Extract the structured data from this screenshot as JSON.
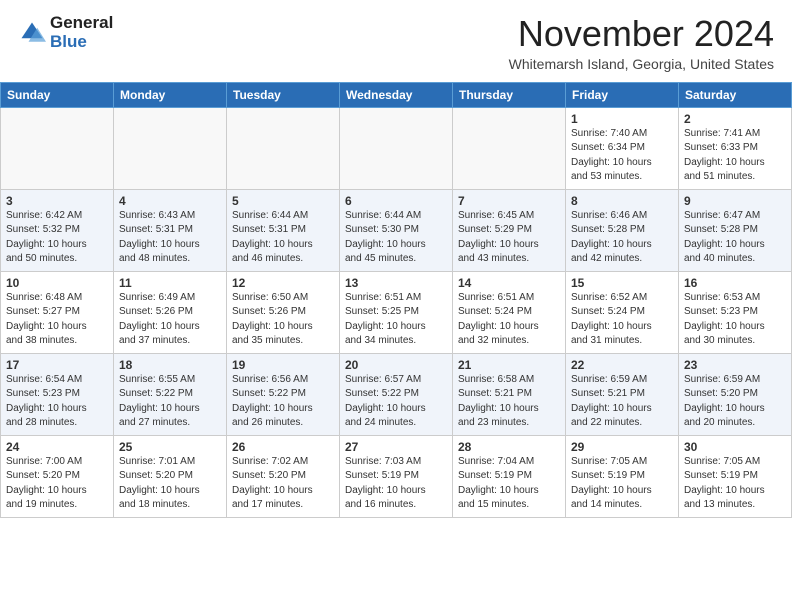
{
  "header": {
    "logo_general": "General",
    "logo_blue": "Blue",
    "month_title": "November 2024",
    "subtitle": "Whitemarsh Island, Georgia, United States"
  },
  "weekdays": [
    "Sunday",
    "Monday",
    "Tuesday",
    "Wednesday",
    "Thursday",
    "Friday",
    "Saturday"
  ],
  "weeks": [
    [
      {
        "day": "",
        "info": ""
      },
      {
        "day": "",
        "info": ""
      },
      {
        "day": "",
        "info": ""
      },
      {
        "day": "",
        "info": ""
      },
      {
        "day": "",
        "info": ""
      },
      {
        "day": "1",
        "info": "Sunrise: 7:40 AM\nSunset: 6:34 PM\nDaylight: 10 hours\nand 53 minutes."
      },
      {
        "day": "2",
        "info": "Sunrise: 7:41 AM\nSunset: 6:33 PM\nDaylight: 10 hours\nand 51 minutes."
      }
    ],
    [
      {
        "day": "3",
        "info": "Sunrise: 6:42 AM\nSunset: 5:32 PM\nDaylight: 10 hours\nand 50 minutes."
      },
      {
        "day": "4",
        "info": "Sunrise: 6:43 AM\nSunset: 5:31 PM\nDaylight: 10 hours\nand 48 minutes."
      },
      {
        "day": "5",
        "info": "Sunrise: 6:44 AM\nSunset: 5:31 PM\nDaylight: 10 hours\nand 46 minutes."
      },
      {
        "day": "6",
        "info": "Sunrise: 6:44 AM\nSunset: 5:30 PM\nDaylight: 10 hours\nand 45 minutes."
      },
      {
        "day": "7",
        "info": "Sunrise: 6:45 AM\nSunset: 5:29 PM\nDaylight: 10 hours\nand 43 minutes."
      },
      {
        "day": "8",
        "info": "Sunrise: 6:46 AM\nSunset: 5:28 PM\nDaylight: 10 hours\nand 42 minutes."
      },
      {
        "day": "9",
        "info": "Sunrise: 6:47 AM\nSunset: 5:28 PM\nDaylight: 10 hours\nand 40 minutes."
      }
    ],
    [
      {
        "day": "10",
        "info": "Sunrise: 6:48 AM\nSunset: 5:27 PM\nDaylight: 10 hours\nand 38 minutes."
      },
      {
        "day": "11",
        "info": "Sunrise: 6:49 AM\nSunset: 5:26 PM\nDaylight: 10 hours\nand 37 minutes."
      },
      {
        "day": "12",
        "info": "Sunrise: 6:50 AM\nSunset: 5:26 PM\nDaylight: 10 hours\nand 35 minutes."
      },
      {
        "day": "13",
        "info": "Sunrise: 6:51 AM\nSunset: 5:25 PM\nDaylight: 10 hours\nand 34 minutes."
      },
      {
        "day": "14",
        "info": "Sunrise: 6:51 AM\nSunset: 5:24 PM\nDaylight: 10 hours\nand 32 minutes."
      },
      {
        "day": "15",
        "info": "Sunrise: 6:52 AM\nSunset: 5:24 PM\nDaylight: 10 hours\nand 31 minutes."
      },
      {
        "day": "16",
        "info": "Sunrise: 6:53 AM\nSunset: 5:23 PM\nDaylight: 10 hours\nand 30 minutes."
      }
    ],
    [
      {
        "day": "17",
        "info": "Sunrise: 6:54 AM\nSunset: 5:23 PM\nDaylight: 10 hours\nand 28 minutes."
      },
      {
        "day": "18",
        "info": "Sunrise: 6:55 AM\nSunset: 5:22 PM\nDaylight: 10 hours\nand 27 minutes."
      },
      {
        "day": "19",
        "info": "Sunrise: 6:56 AM\nSunset: 5:22 PM\nDaylight: 10 hours\nand 26 minutes."
      },
      {
        "day": "20",
        "info": "Sunrise: 6:57 AM\nSunset: 5:22 PM\nDaylight: 10 hours\nand 24 minutes."
      },
      {
        "day": "21",
        "info": "Sunrise: 6:58 AM\nSunset: 5:21 PM\nDaylight: 10 hours\nand 23 minutes."
      },
      {
        "day": "22",
        "info": "Sunrise: 6:59 AM\nSunset: 5:21 PM\nDaylight: 10 hours\nand 22 minutes."
      },
      {
        "day": "23",
        "info": "Sunrise: 6:59 AM\nSunset: 5:20 PM\nDaylight: 10 hours\nand 20 minutes."
      }
    ],
    [
      {
        "day": "24",
        "info": "Sunrise: 7:00 AM\nSunset: 5:20 PM\nDaylight: 10 hours\nand 19 minutes."
      },
      {
        "day": "25",
        "info": "Sunrise: 7:01 AM\nSunset: 5:20 PM\nDaylight: 10 hours\nand 18 minutes."
      },
      {
        "day": "26",
        "info": "Sunrise: 7:02 AM\nSunset: 5:20 PM\nDaylight: 10 hours\nand 17 minutes."
      },
      {
        "day": "27",
        "info": "Sunrise: 7:03 AM\nSunset: 5:19 PM\nDaylight: 10 hours\nand 16 minutes."
      },
      {
        "day": "28",
        "info": "Sunrise: 7:04 AM\nSunset: 5:19 PM\nDaylight: 10 hours\nand 15 minutes."
      },
      {
        "day": "29",
        "info": "Sunrise: 7:05 AM\nSunset: 5:19 PM\nDaylight: 10 hours\nand 14 minutes."
      },
      {
        "day": "30",
        "info": "Sunrise: 7:05 AM\nSunset: 5:19 PM\nDaylight: 10 hours\nand 13 minutes."
      }
    ]
  ]
}
